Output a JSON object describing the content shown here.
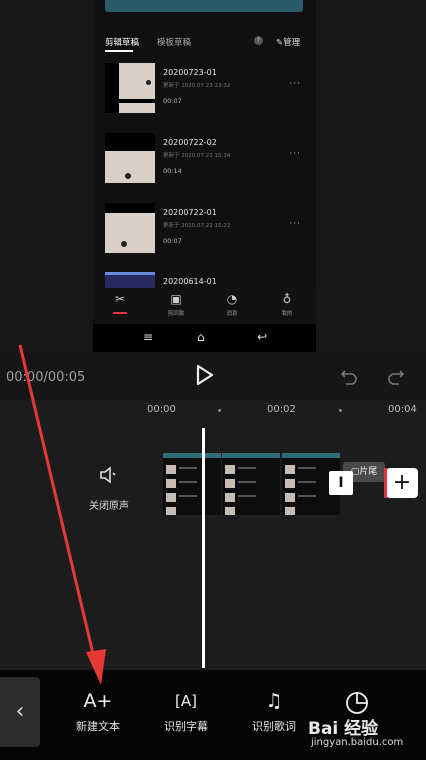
{
  "preview": {
    "tabs": {
      "drafts": "剪辑草稿",
      "templates": "模板草稿",
      "help_icon": "?",
      "manage": "管理"
    },
    "drafts": [
      {
        "title": "20200723-01",
        "updated": "更新于 2020.07.23 23:32",
        "duration": "00:07"
      },
      {
        "title": "20200722-02",
        "updated": "更新于 2020.07.22 15:34",
        "duration": "00:14"
      },
      {
        "title": "20200722-01",
        "updated": "更新于 2020.07.22 15:22",
        "duration": "00:07"
      },
      {
        "title": "20200614-01",
        "updated": "",
        "duration": ""
      }
    ],
    "more": "···",
    "bottom_nav": [
      {
        "icon": "scissors-icon",
        "glyph": "✂",
        "label": ""
      },
      {
        "icon": "play-icon",
        "glyph": "▣",
        "label": "剪同款"
      },
      {
        "icon": "bell-icon",
        "glyph": "◔",
        "label": "消息"
      },
      {
        "icon": "person-icon",
        "glyph": "♁",
        "label": "我的"
      }
    ],
    "system_nav": {
      "menu": "≡",
      "home": "⌂",
      "back": "↩"
    }
  },
  "controls": {
    "time": "00:00/00:05",
    "play": "▶",
    "undo": "↶",
    "redo": "↷"
  },
  "timeline": {
    "ticks": [
      "00:00",
      "00:02",
      "00:04"
    ],
    "mute_label": "关闭原声",
    "end_label": "片尾",
    "trim": "I",
    "add": "+"
  },
  "toolbar": {
    "back": "‹",
    "tools": [
      {
        "icon": "new-text-icon",
        "glyph": "A+",
        "label": "新建文本"
      },
      {
        "icon": "subtitle-recognition-icon",
        "glyph": "[A]",
        "label": "识别字幕"
      },
      {
        "icon": "lyrics-recognition-icon",
        "glyph": "♫",
        "label": "识别歌词"
      }
    ]
  },
  "watermark": {
    "text": "Bai 经验",
    "url": "jingyan.baidu.com"
  },
  "colors": {
    "accent_red": "#e5343c",
    "clip_band": "#2e6a78",
    "arrow": "#e53935"
  }
}
